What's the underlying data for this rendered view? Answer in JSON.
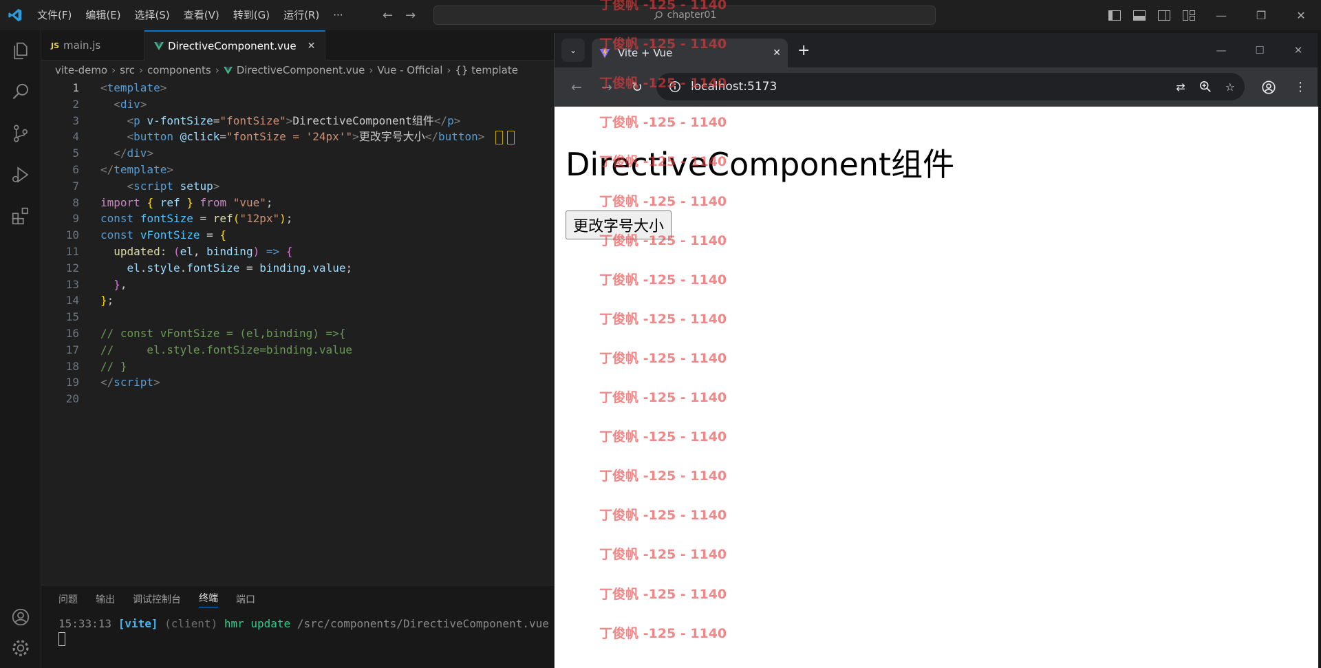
{
  "titlebar": {
    "menu": [
      "文件(F)",
      "编辑(E)",
      "选择(S)",
      "查看(V)",
      "转到(G)",
      "运行(R)",
      "···"
    ],
    "search_text": "chapter01",
    "minimize": "—",
    "restore": "❐",
    "close": "✕"
  },
  "editor": {
    "tabs": [
      {
        "badge": "JS",
        "label": "main.js"
      },
      {
        "label": "DirectiveComponent.vue",
        "close": "✕"
      }
    ],
    "breadcrumb": [
      "vite-demo",
      "src",
      "components",
      "DirectiveComponent.vue",
      "Vue - Official",
      "{} template"
    ],
    "line_numbers": [
      "1",
      "2",
      "3",
      "4",
      "5",
      "6",
      "7",
      "8",
      "9",
      "10",
      "11",
      "12",
      "13",
      "14",
      "15",
      "16",
      "17",
      "18",
      "19",
      "20"
    ],
    "code": {
      "l1_tag": "template",
      "l2_tag": "div",
      "l3_tag": "p",
      "l3_attr": "v-fontSize",
      "l3_val": "\"fontSize\"",
      "l3_text": "DirectiveComponent组件",
      "l4_tag": "button",
      "l4_attr": "@click",
      "l4_val_a": "\"fontSize = ",
      "l4_val_b": "'24px'",
      "l4_val_c": "\"",
      "l4_text": "更改字号大小",
      "l7_tag": "script",
      "l7_attr": "setup",
      "l8_import": "import",
      "l8_ref": "ref",
      "l8_from": "from",
      "l8_str": "\"vue\"",
      "l9_const": "const",
      "l9_name": "fontSize",
      "l9_fn": "ref",
      "l9_str": "\"12px\"",
      "l10_const": "const",
      "l10_name": "vFontSize",
      "l11_key": "updated",
      "l11_el": "el",
      "l11_binding": "binding",
      "l12_el": "el",
      "l12_style": "style",
      "l12_fs": "fontSize",
      "l12_binding": "binding",
      "l12_value": "value",
      "l16": "// const vFontSize = (el,binding) =>{",
      "l17": "//     el.style.fontSize=binding.value",
      "l18": "// }",
      "l19_tag": "script"
    }
  },
  "panel": {
    "tabs": [
      "问题",
      "输出",
      "调试控制台",
      "终端",
      "端口"
    ],
    "terminal": {
      "time": "15:33:13",
      "vite": "[vite]",
      "client": "(client)",
      "hmr": "hmr update",
      "path": "/src/components/DirectiveComponent.vue"
    }
  },
  "browser": {
    "tab_title": "Vite + Vue",
    "url": "localhost:5173",
    "page": {
      "heading": "DirectiveComponent组件",
      "button": "更改字号大小"
    }
  },
  "watermark": {
    "text": "丁俊帆 -125 - 1140",
    "repeat_count": 17
  },
  "colors": {
    "accent": "#0078d4",
    "watermark": "#eb3c3c"
  }
}
